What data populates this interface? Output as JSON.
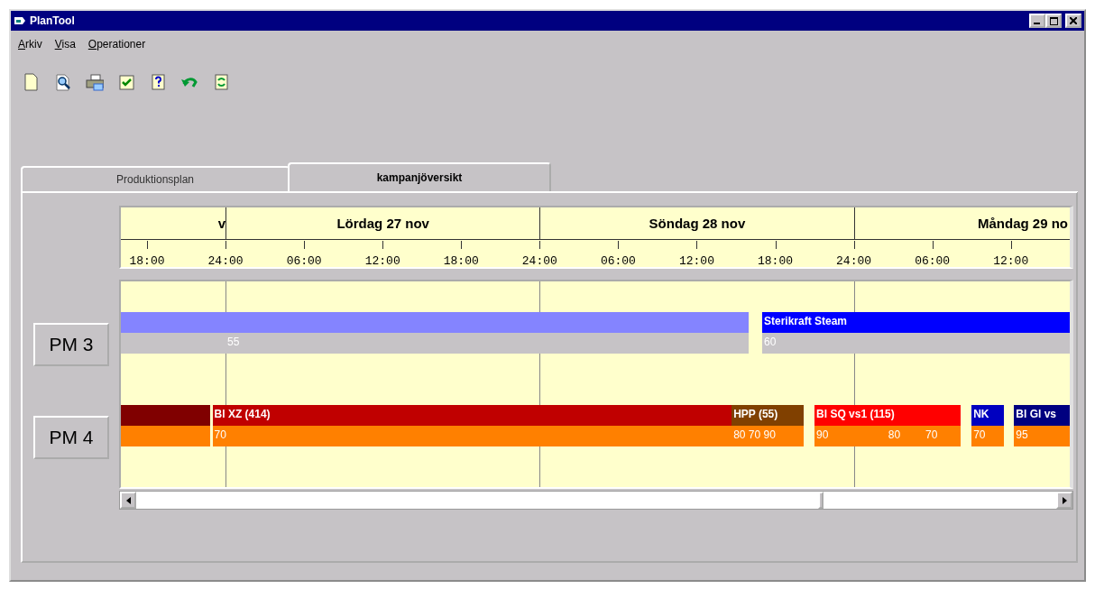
{
  "window": {
    "title": "PlanTool"
  },
  "menu": [
    {
      "label": "Arkiv"
    },
    {
      "label": "Visa"
    },
    {
      "label": "Operationer"
    }
  ],
  "toolbar": [
    {
      "kind": "new"
    },
    {
      "kind": "search"
    },
    {
      "kind": "print"
    },
    {
      "kind": "check"
    },
    {
      "kind": "help"
    },
    {
      "kind": "undo"
    },
    {
      "kind": "refresh"
    }
  ],
  "tabs": [
    {
      "label": "Produktionsplan",
      "selected": false
    },
    {
      "label": "kampanjöversikt",
      "selected": true
    }
  ],
  "timeline": {
    "days": [
      {
        "label": "v"
      },
      {
        "label": "Lördag 27 nov"
      },
      {
        "label": "Söndag 28 nov"
      },
      {
        "label": "Måndag 29 no"
      }
    ],
    "ticks": [
      {
        "label": "18:00"
      },
      {
        "label": "24:00"
      },
      {
        "label": "06:00"
      },
      {
        "label": "12:00"
      },
      {
        "label": "18:00"
      },
      {
        "label": "24:00"
      },
      {
        "label": "06:00"
      },
      {
        "label": "12:00"
      },
      {
        "label": "18:00"
      },
      {
        "label": "24:00"
      },
      {
        "label": "06:00"
      },
      {
        "label": "12:00"
      }
    ]
  },
  "machines": [
    {
      "name": "PM 3",
      "campaigns": [
        {
          "color": "#8484ff"
        },
        {
          "label": "Sterikraft Steam",
          "color": "#0000ff"
        }
      ],
      "speeds": [
        {
          "color": "#c6c3c6"
        },
        {
          "label": "55",
          "color": "#c6c3c6"
        },
        {
          "label": "60",
          "color": "#c6c3c6"
        }
      ]
    },
    {
      "name": "PM 4",
      "campaigns": [
        {
          "color": "#800000"
        },
        {
          "label": "Bl XZ (414)",
          "color": "#c00000"
        },
        {
          "label": "HPP (55)",
          "color": "#804000"
        },
        {
          "label": "Bl SQ vs1 (115)",
          "color": "#ff0000"
        },
        {
          "label": "NK",
          "color": "#0000c0"
        },
        {
          "label": "Bl Gl vs",
          "color": "#000080"
        }
      ],
      "speeds": [
        {
          "color": "#ff8000"
        },
        {
          "label": "70",
          "color": "#ff8000"
        },
        {
          "label": "80 70 90",
          "color": "#ff8000"
        },
        {
          "label": "90",
          "color": "#ff8000"
        },
        {
          "label": "80",
          "color": "#ff8000"
        },
        {
          "label": "70",
          "color": "#ff8000"
        },
        {
          "label": "70",
          "color": "#ff8000"
        },
        {
          "label": "95",
          "color": "#ff8000"
        }
      ]
    }
  ]
}
